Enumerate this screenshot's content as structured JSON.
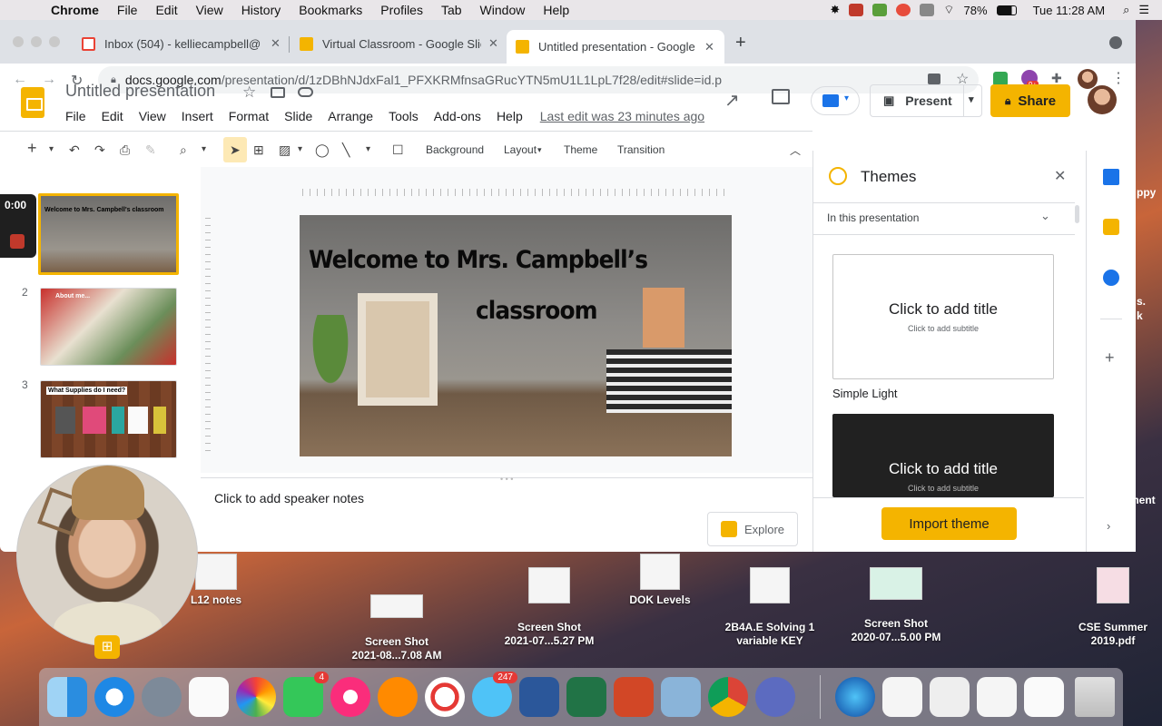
{
  "menubar": {
    "app": "Chrome",
    "items": [
      "File",
      "Edit",
      "View",
      "History",
      "Bookmarks",
      "Profiles",
      "Tab",
      "Window",
      "Help"
    ],
    "battery": "78%",
    "clock": "Tue 11:28 AM"
  },
  "browser": {
    "tabs": [
      {
        "title": "Inbox (504) - kelliecampbell@",
        "color": "#ea4335"
      },
      {
        "title": "Virtual Classroom - Google Slic",
        "color": "#f4b400"
      },
      {
        "title": "Untitled presentation - Google",
        "color": "#f4b400"
      }
    ],
    "url_domain": "docs.google.com",
    "url_path": "/presentation/d/1zDBhNJdxFal1_PFXKRMfnsaGRucYTN5mU1L1LpL7f28/edit#slide=id.p",
    "extension_badge": "9+"
  },
  "doc": {
    "title": "Untitled presentation",
    "menu": [
      "File",
      "Edit",
      "View",
      "Insert",
      "Format",
      "Slide",
      "Arrange",
      "Tools",
      "Add-ons",
      "Help"
    ],
    "last_edit": "Last edit was 23 minutes ago",
    "present_label": "Present",
    "share_label": "Share"
  },
  "toolbar": {
    "background": "Background",
    "layout": "Layout",
    "theme": "Theme",
    "transition": "Transition"
  },
  "filmstrip": {
    "timer": "0:00",
    "slides": [
      {
        "num": "1",
        "text": "Welcome to Mrs. Campbell's classroom"
      },
      {
        "num": "2",
        "text": "About me..."
      },
      {
        "num": "3",
        "text": "What Supplies do I need?"
      }
    ]
  },
  "slide": {
    "title_line1": "Welcome to Mrs. Campbell’s",
    "title_line2": "classroom"
  },
  "notes_placeholder": "Click to add speaker notes",
  "explore_label": "Explore",
  "themes": {
    "heading": "Themes",
    "section": "In this presentation",
    "card1_title": "Click to add title",
    "card1_subtitle": "Click to add subtitle",
    "card1_name": "Simple Light",
    "card2_title": "Click to add title",
    "card2_subtitle": "Click to add subtitle",
    "import_label": "Import theme"
  },
  "desktop": {
    "files": [
      {
        "name": "L12 notes"
      },
      {
        "name": "Screen Shot\n2021-08...7.08 AM"
      },
      {
        "name": "Screen Shot\n2021-07...5.27 PM"
      },
      {
        "name": "DOK Levels"
      },
      {
        "name": "2B4A.E Solving 1\nvariable KEY"
      },
      {
        "name": "Screen Shot\n2020-07...5.00 PM"
      },
      {
        "name": "CSE Summer\n2019.pdf"
      }
    ],
    "edge_labels": [
      "ppy",
      "s.",
      "k",
      "ment"
    ]
  },
  "dock": {
    "facetime_badge": "4",
    "messages_badge": "247"
  }
}
